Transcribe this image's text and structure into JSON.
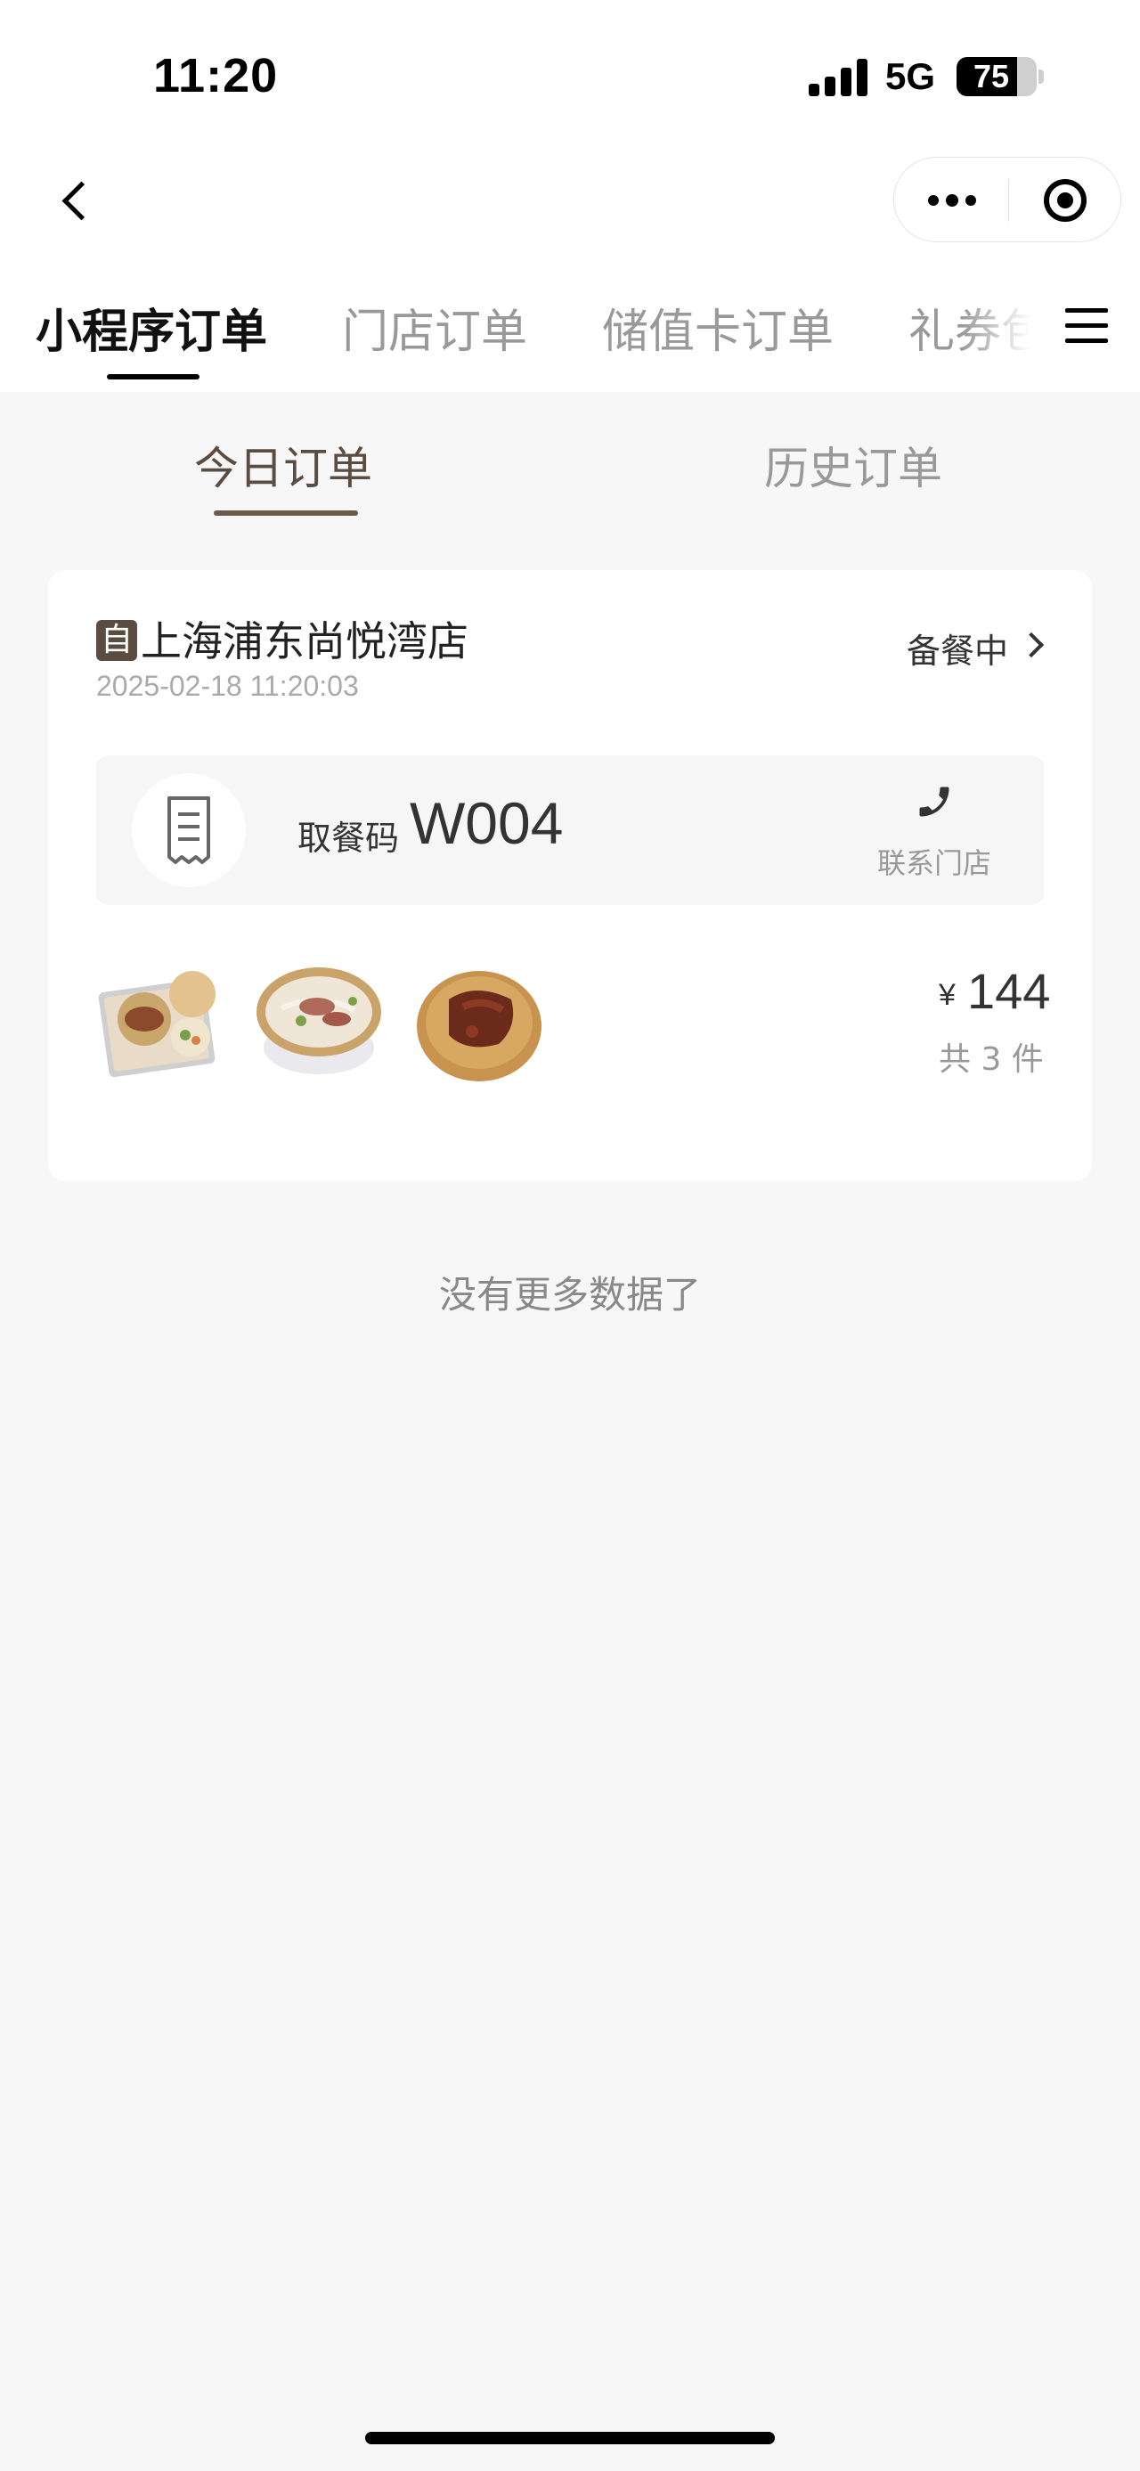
{
  "status_bar": {
    "time": "11:20",
    "network": "5G",
    "battery": "75",
    "battery_level": 0.75
  },
  "nav": {
    "back_icon": "chevron-left-icon",
    "more_icon": "more-dots-icon",
    "close_icon": "target-circle-icon"
  },
  "top_tabs": [
    {
      "label": "小程序订单",
      "active": true
    },
    {
      "label": "门店订单",
      "active": false
    },
    {
      "label": "储值卡订单",
      "active": false
    },
    {
      "label": "礼券包",
      "active": false
    }
  ],
  "sub_tabs": [
    {
      "label": "今日订单",
      "active": true
    },
    {
      "label": "历史订单",
      "active": false
    }
  ],
  "order": {
    "badge": "自",
    "store_name": "上海浦东尚悦湾店",
    "datetime": "2025-02-18 11:20:03",
    "status": "备餐中",
    "pickup_label": "取餐码",
    "pickup_code": "W004",
    "contact_label": "联系门店",
    "currency": "¥",
    "price": "144",
    "item_count": "共 3 件",
    "items": [
      "food-image-1",
      "food-image-2",
      "food-image-3"
    ]
  },
  "footer_text": "没有更多数据了",
  "colors": {
    "accent": "#5a4c40",
    "background": "#f7f7f7"
  }
}
